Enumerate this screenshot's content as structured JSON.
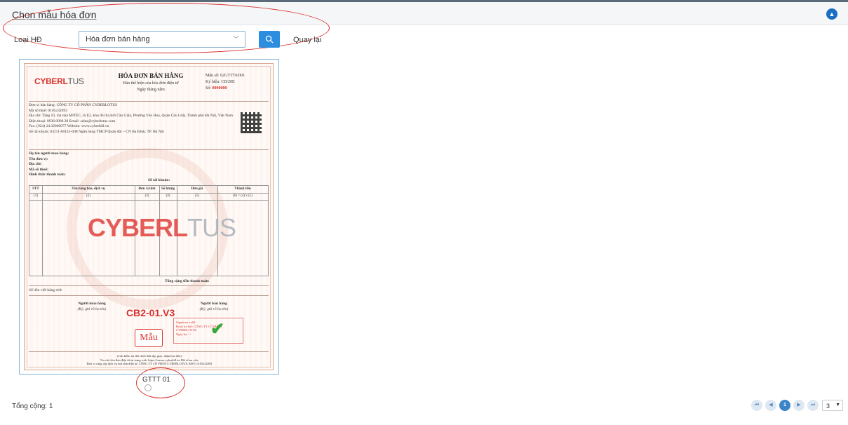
{
  "header": {
    "title": "Chọn mẫu hóa đơn",
    "collapse_icon": "chevron-up-icon"
  },
  "filter": {
    "label": "Loại HĐ",
    "selected": "Hóa đơn bán hàng",
    "search_icon": "search-icon",
    "back_label": "Quay lại"
  },
  "invoice": {
    "logo_main": "CYBERL",
    "logo_rest": "TUS",
    "title": "HÓA ĐƠN BÁN HÀNG",
    "subtitle": "Bản thể hiện của hóa đơn điện tử",
    "date_line": "Ngày   tháng   năm",
    "form_no": "Mẫu số: 02GTTT0/001",
    "symbol": "Ký hiệu: CB/20E",
    "number_label": "Số:",
    "number": "0000000",
    "seller": [
      "Đơn vị bán hàng: CÔNG TY CỔ PHẦN CYBERLOTUS",
      "Mã số thuế: 0105232093",
      "Địa chỉ: Tầng 10, tòa nhà MITEC, lô E2, khu đô thị mới Cầu Giấy, Phường Yên Hoà, Quận Cầu Giấy, Thành phố Hà Nội, Việt Nam",
      "Điện thoại: 0936.0000.38          Email: sales@cyberlotus.com",
      "Fax: (024) 24.32000077          Website: www.cyberbill.vn",
      "Số tài khoản: 83211-00141-008  Ngân hàng TMCP Quân đội – CN Ba Đình, TP. Hà Nội"
    ],
    "buyer": [
      "Họ tên người mua hàng:",
      "Tên đơn vị:",
      "Địa chỉ:",
      "Mã số thuế:",
      "Hình thức thanh toán:"
    ],
    "buyer_account": "Số tài khoản:",
    "table_headers": [
      "STT",
      "Tên hàng hóa, dịch vụ",
      "Đơn vị tính",
      "Số lượng",
      "Đơn giá",
      "Thành tiền"
    ],
    "table_index": [
      "(1)",
      "(2)",
      "(3)",
      "(4)",
      "(5)",
      "(6) = (4) x (5)"
    ],
    "total_label": "Tổng cộng tiền thanh toán:",
    "in_words": "Số tiền viết bằng chữ:",
    "buyer_sign": "Người mua hàng",
    "buyer_sign_note": "(Ký, ghi rõ họ tên)",
    "seller_sign": "Người bán hàng",
    "seller_sign_note": "(Ký, ghi rõ họ tên)",
    "template_code": "CB2-01.V3",
    "stamp": "Mẫu",
    "signature_text": "Signature valid\nĐược ký bởi: CÔNG TY CỔ PHẦN\nCYBERLOTUS\nNgày ký: / /",
    "footer": "(Cần kiểm tra đối chiếu khi lập, giao, nhận hóa đơn)\nTra cứu hóa đơn điện tử tại trang web: https://tracuu.cyberbill.vn   Mã số tra cứu:\nĐơn vị cung cấp dịch vụ hóa đơn điện tử: CÔNG TY CỔ PHẦN CYBERLOTUS, MST: 0105232093"
  },
  "template": {
    "name": "GTTT 01",
    "selected": false
  },
  "footer": {
    "total": "Tổng cộng: 1"
  },
  "pagination": {
    "first_icon": "first-page-icon",
    "prev_icon": "prev-page-icon",
    "current": "1",
    "next_icon": "next-page-icon",
    "last_icon": "last-page-icon",
    "page_size": "3"
  },
  "colors": {
    "accent": "#2d8ee0",
    "highlight": "#d9312c",
    "brand_red": "#e24b47"
  }
}
